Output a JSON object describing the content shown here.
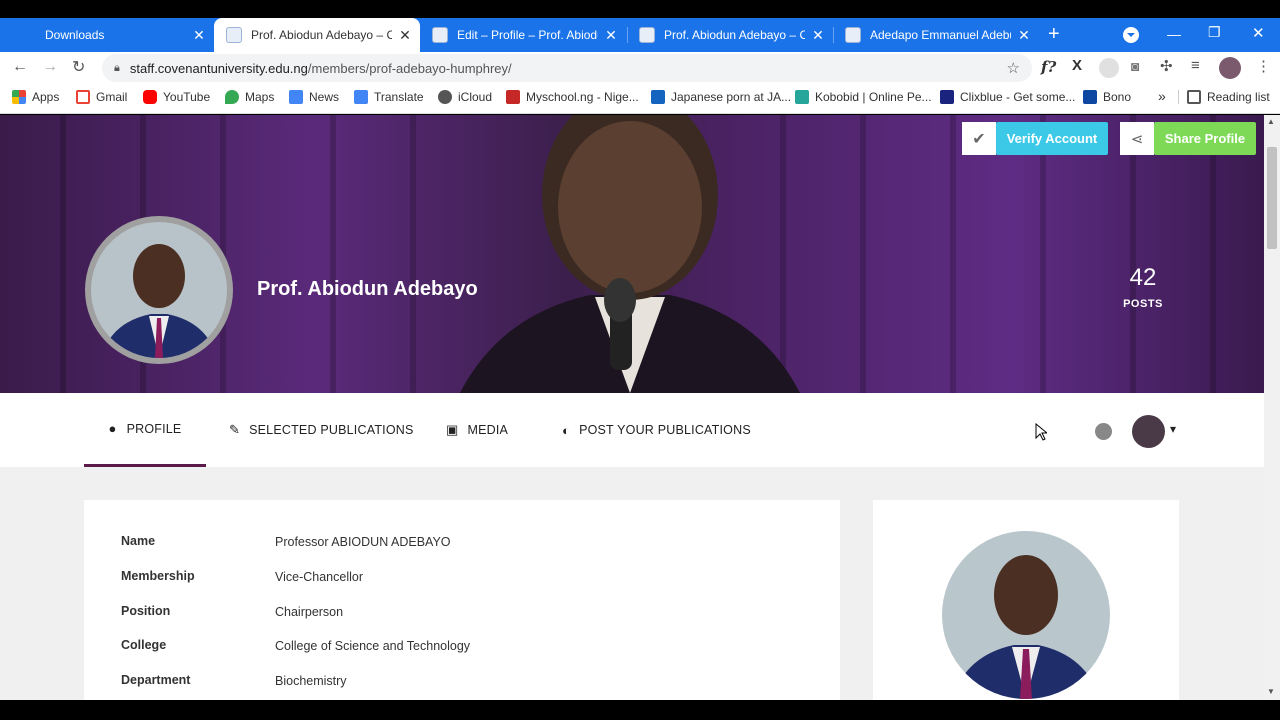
{
  "tabs": [
    {
      "title": "Downloads"
    },
    {
      "title": "Prof. Abiodun Adebayo – Co"
    },
    {
      "title": "Edit – Profile – Prof. Abiodun"
    },
    {
      "title": "Prof. Abiodun Adebayo – Co"
    },
    {
      "title": "Adedapo Emmanuel Adebus"
    }
  ],
  "omnibox": {
    "url_host": "staff.covenantuniversity.edu.ng",
    "url_path": "/members/prof-adebayo-humphrey/"
  },
  "bookmarks": [
    {
      "label": "Apps",
      "icon": "apps-grid-icon"
    },
    {
      "label": "Gmail",
      "icon": "gmail-icon"
    },
    {
      "label": "YouTube",
      "icon": "youtube-icon"
    },
    {
      "label": "Maps",
      "icon": "maps-icon"
    },
    {
      "label": "News",
      "icon": "news-icon"
    },
    {
      "label": "Translate",
      "icon": "translate-icon"
    },
    {
      "label": "iCloud",
      "icon": "apple-icon"
    },
    {
      "label": "Myschool.ng - Nige...",
      "icon": "myschool-icon"
    },
    {
      "label": "Japanese porn at JA...",
      "icon": "site-icon"
    },
    {
      "label": "Kobobid | Online Pe...",
      "icon": "kobobid-icon"
    },
    {
      "label": "Clixblue - Get some...",
      "icon": "clixblue-icon"
    },
    {
      "label": "Bono",
      "icon": "bono-icon"
    }
  ],
  "reading_list": "Reading list",
  "overflow": "»",
  "hero": {
    "verify_label": "Verify Account",
    "share_label": "Share Profile",
    "name": "Prof. Abiodun Adebayo",
    "posts_count": "42",
    "posts_label": "POSTS"
  },
  "nav": {
    "profile": "PROFILE",
    "publications": "SELECTED PUBLICATIONS",
    "media": "MEDIA",
    "post": "POST YOUR PUBLICATIONS"
  },
  "profile_fields": [
    {
      "label": "Name",
      "value": "Professor ABIODUN ADEBAYO"
    },
    {
      "label": "Membership",
      "value": "Vice-Chancellor"
    },
    {
      "label": "Position",
      "value": "Chairperson"
    },
    {
      "label": "College",
      "value": "College of Science and Technology"
    },
    {
      "label": "Department",
      "value": "Biochemistry"
    }
  ],
  "colors": {
    "tabstrip": "#1a73e8",
    "hero": "#4d2367",
    "verify": "#3cc9e8",
    "share": "#7ed957",
    "active_tab_underline": "#5a1a4a"
  }
}
